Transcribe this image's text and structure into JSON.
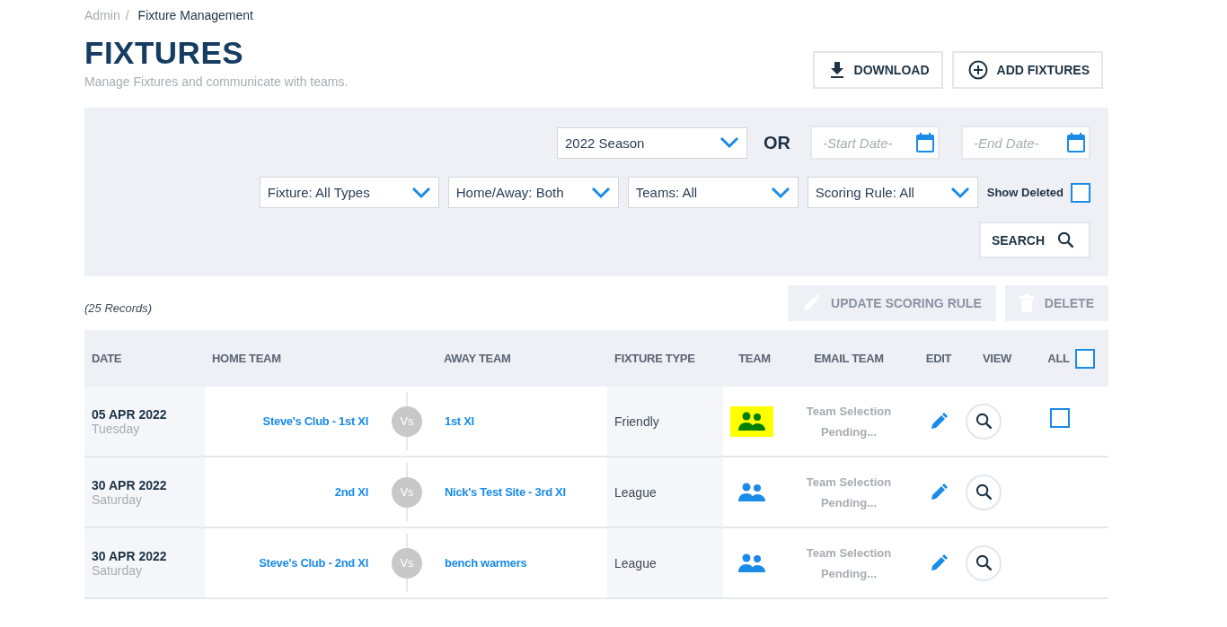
{
  "breadcrumb": [
    {
      "label": "Admin",
      "current": false
    },
    {
      "label": "Fixture Management",
      "current": true
    }
  ],
  "breadcrumb_separator": "/",
  "page": {
    "title": "FIXTURES",
    "subtitle": "Manage Fixtures and communicate with teams."
  },
  "header_buttons": [
    {
      "kind": "download",
      "label": "DOWNLOAD"
    },
    {
      "kind": "add",
      "label": "ADD FIXTURES"
    }
  ],
  "filters": {
    "season": "2022 Season",
    "or_label": "OR",
    "start_date": {
      "placeholder": "-Start Date-"
    },
    "end_date": {
      "placeholder": "-End Date-"
    },
    "dropdowns": [
      "Fixture: All Types",
      "Home/Away: Both",
      "Teams: All",
      "Scoring Rule: All"
    ],
    "show_deleted": {
      "label": "Show Deleted",
      "checked": false
    },
    "search_button": "SEARCH"
  },
  "records": "(25 Records)",
  "bulk_actions": [
    {
      "kind": "edit",
      "label": "UPDATE SCORING RULE",
      "disabled": true
    },
    {
      "kind": "delete",
      "label": "DELETE",
      "disabled": true
    }
  ],
  "table": {
    "columns": [
      "DATE",
      "HOME TEAM",
      "AWAY TEAM",
      "FIXTURE TYPE",
      "TEAM",
      "EMAIL TEAM",
      "EDIT",
      "VIEW",
      "ALL"
    ],
    "select_all": {
      "checked": false
    },
    "rows": [
      {
        "date": "05 APR 2022",
        "day": "Tuesday",
        "home": "Steve's Club - 1st XI",
        "vs": "Vs",
        "away": "1st XI",
        "type": "Friendly",
        "team_highlighted": true,
        "email": "Team Selection Pending...",
        "checked": false
      },
      {
        "date": "30 APR 2022",
        "day": "Saturday",
        "home": "2nd XI",
        "vs": "Vs",
        "away": "Nick's Test Site - 3rd XI",
        "type": "League",
        "team_highlighted": false,
        "email": "Team Selection Pending..."
      },
      {
        "date": "30 APR 2022",
        "day": "Saturday",
        "home": "Steve's Club - 2nd XI",
        "vs": "Vs",
        "away": "bench warmers",
        "type": "League",
        "team_highlighted": false,
        "email": "Team Selection Pending..."
      }
    ]
  }
}
